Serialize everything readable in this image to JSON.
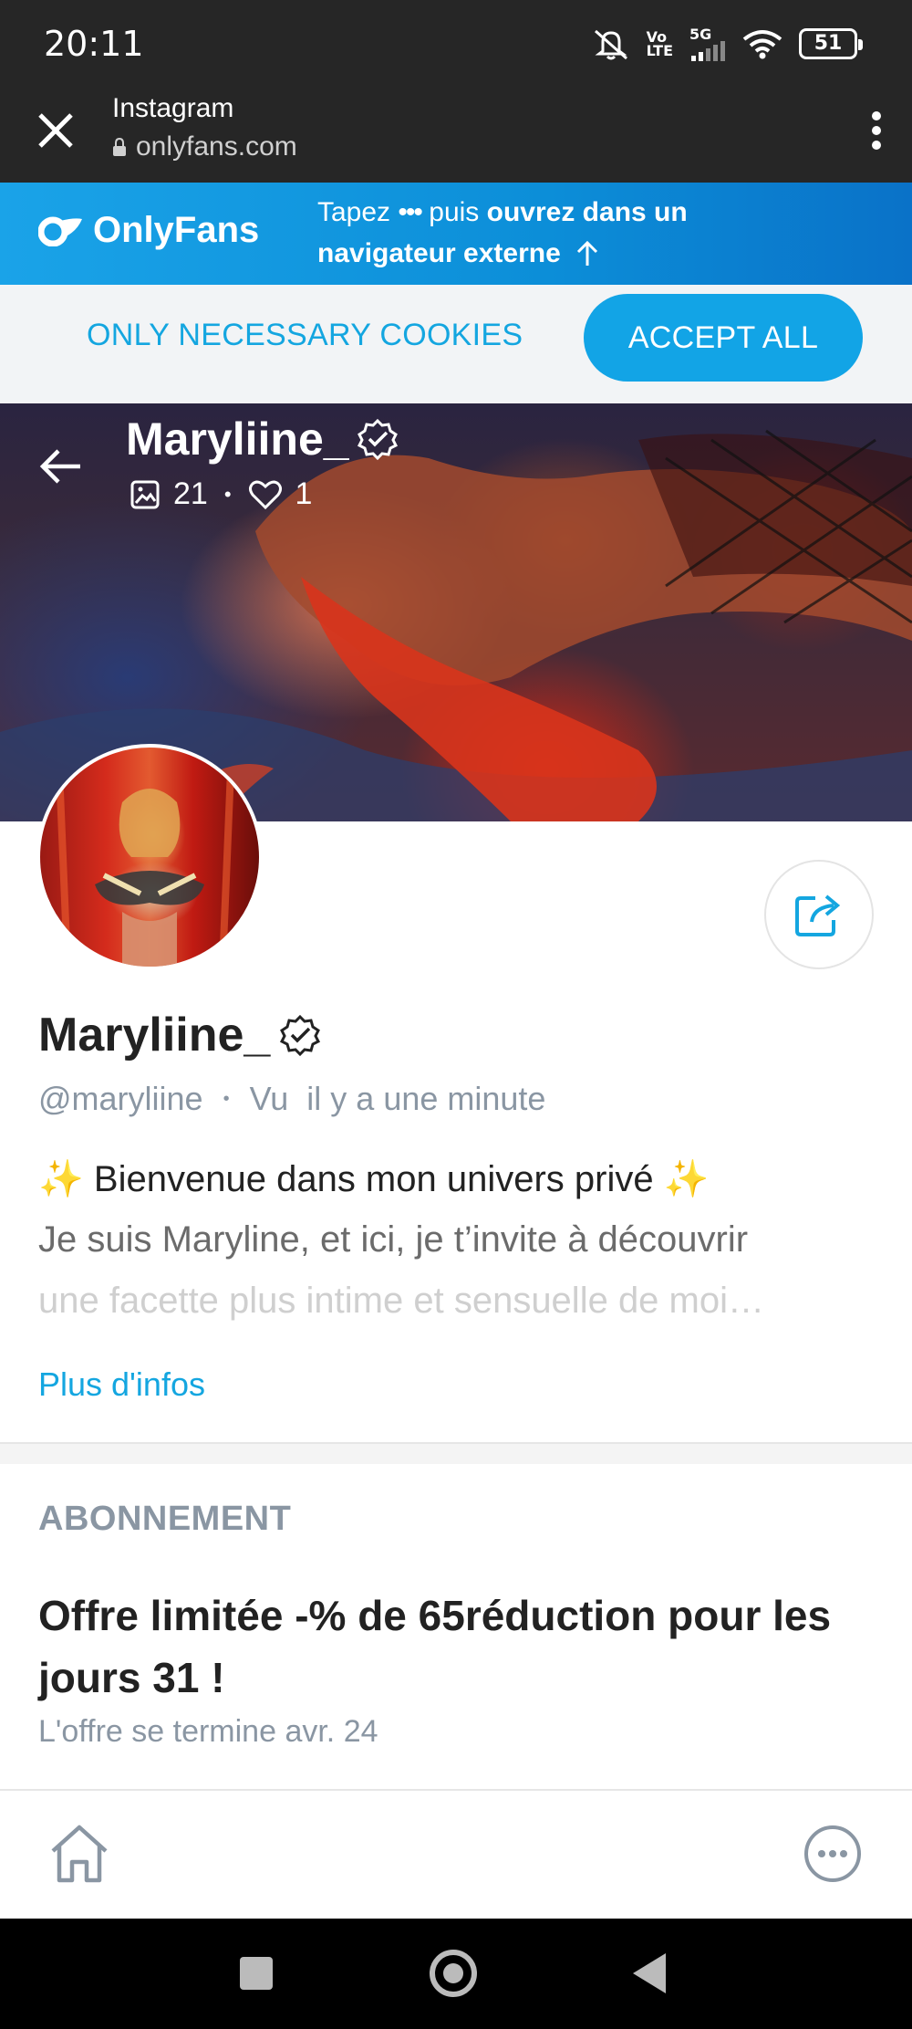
{
  "status_bar": {
    "time": "20:11",
    "signal_label_top": "Vo",
    "signal_label_bottom": "LTE",
    "network": "5G",
    "battery": "51"
  },
  "browser": {
    "title": "Instagram",
    "url": "onlyfans.com"
  },
  "banner": {
    "brand": "OnlyFans",
    "msg_pre": "Tapez",
    "msg_dots": "•••",
    "msg_mid": "puis",
    "msg_bold": "ouvrez dans un navigateur externe",
    "brand_color": "#12a4e6"
  },
  "cookies": {
    "necessary_label": "ONLY NECESSARY COOKIES",
    "accept_label": "ACCEPT ALL"
  },
  "cover": {
    "name": "Maryliine_",
    "photos_count": "21",
    "likes_count": "1"
  },
  "profile": {
    "name": "Maryliine_",
    "handle": "@maryliine",
    "last_seen": "Vu  il y a une minute",
    "bio_line1": "✨ Bienvenue dans mon univers privé ✨",
    "bio_line2": "Je suis Maryline, et ici, je t’invite à découvrir",
    "bio_line3": "une facette plus intime et sensuelle de moi…",
    "more_info": "Plus d'infos"
  },
  "subscription": {
    "heading": "ABONNEMENT",
    "offer_title": "Offre limitée -% de 65réduction pour les jours 31 !",
    "offer_end": "L'offre se termine avr. 24"
  },
  "icons": {
    "close": "close-icon",
    "lock": "lock-icon",
    "menu": "more-vert-icon",
    "back": "arrow-back-icon",
    "verified": "verified-icon",
    "image": "image-icon",
    "heart": "heart-icon",
    "share": "share-icon",
    "home": "home-icon",
    "more": "more-horiz-icon"
  }
}
